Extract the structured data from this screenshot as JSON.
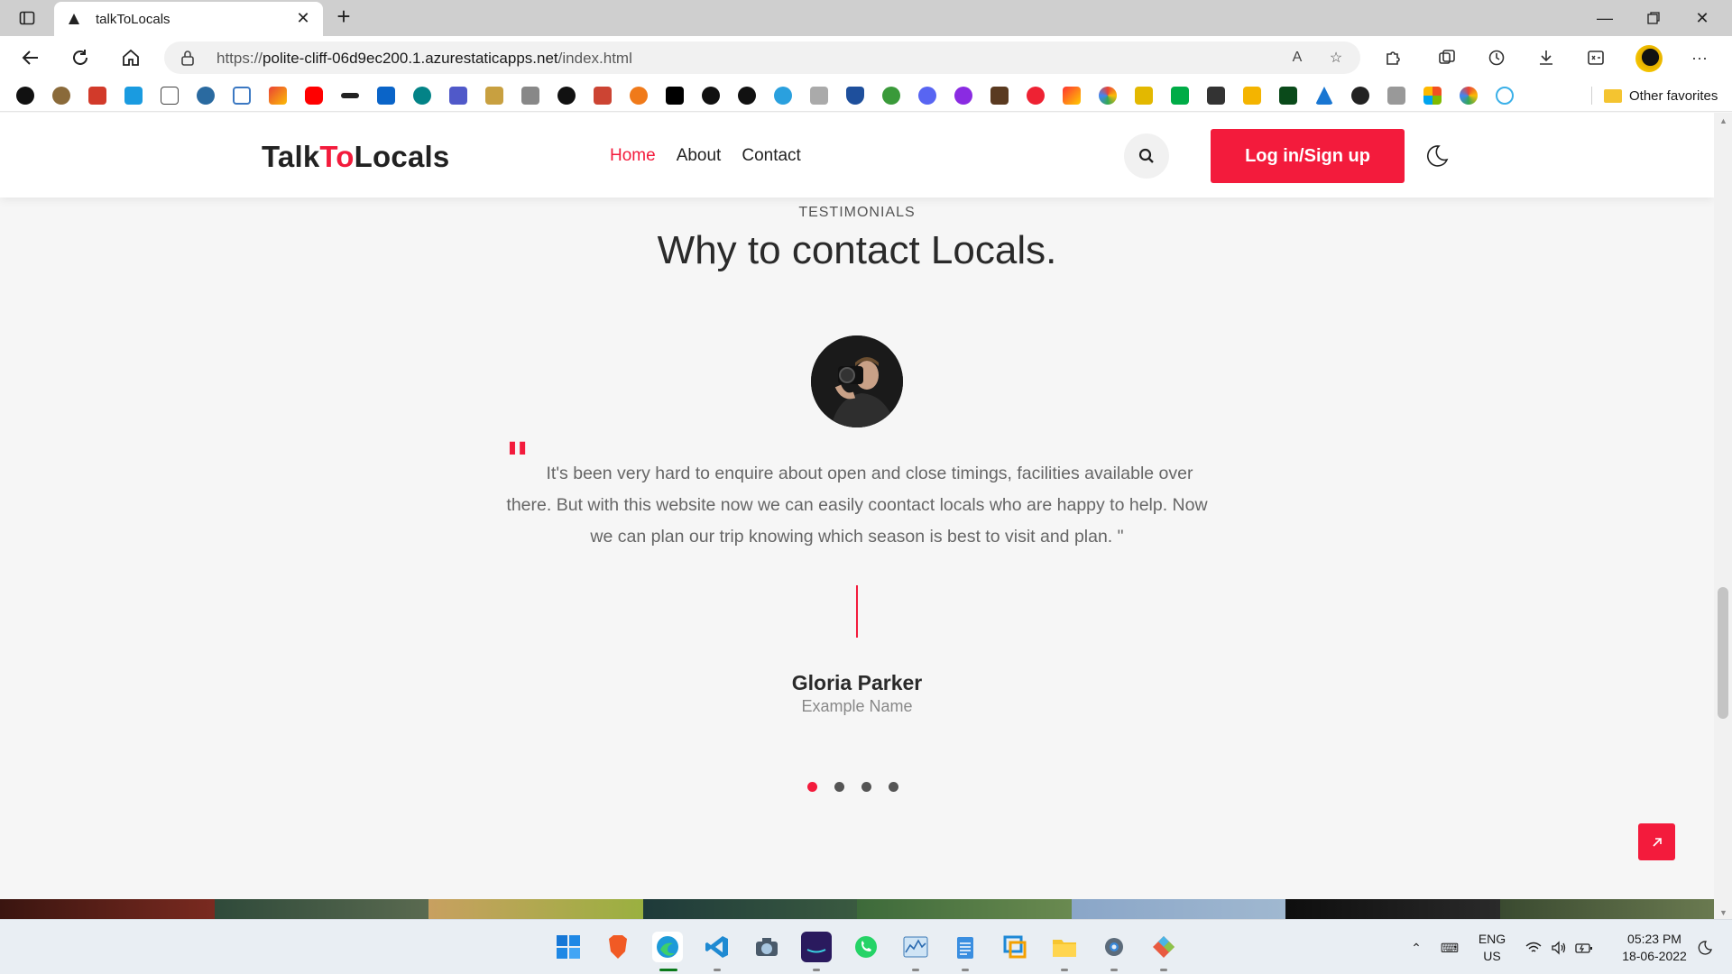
{
  "browser": {
    "tab_title": "talkToLocals",
    "new_tab": "+",
    "url_host_prefix": "https://",
    "url_host": "polite-cliff-06d9ec200.1.azurestaticapps.net",
    "url_path": "/index.html",
    "other_favorites": "Other favorites",
    "favorites_icons": [
      "wikipedia",
      "pdf",
      "pdf-red",
      "istock",
      "file",
      "wordpress",
      "square",
      "gmail",
      "youtube",
      "dots",
      "outlook",
      "sharepoint",
      "teams",
      "tool",
      "image",
      "circle",
      "grid",
      "flame",
      "hacker",
      "github",
      "github-2",
      "telegram",
      "keyboard",
      "shield",
      "circle-green",
      "discord",
      "purple-u",
      "cc",
      "no",
      "tool-2",
      "google",
      "camera",
      "meet",
      "tags",
      "box",
      "usf",
      "azure",
      "globe",
      "gear",
      "microsoft",
      "google-2",
      "cloud"
    ],
    "accent": "#f31b3c"
  },
  "site": {
    "logo_part1": "Talk",
    "logo_part2": "To",
    "logo_part3": "Locals",
    "nav": [
      "Home",
      "About",
      "Contact"
    ],
    "active_nav": "Home",
    "login_label": "Log in/Sign up"
  },
  "testimonials": {
    "subheading": "TESTIMONIALS",
    "heading": "Why to contact Locals.",
    "quote_mark": "\"",
    "quote": "It's been very hard to enquire about open and close timings, facilities available over there. But with this website now we can easily coontact locals who are happy to help. Now we can plan our trip knowing which season is best to visit and plan. \"",
    "name": "Gloria Parker",
    "role": "Example Name",
    "slides": 4,
    "active_slide": 1
  },
  "taskbar": {
    "apps": [
      "start-icon",
      "brave-icon",
      "edge-icon",
      "vscode-icon",
      "camera-icon",
      "amazon-music-icon",
      "whatsapp-icon",
      "monitor-icon",
      "notepad-icon",
      "remote-desktop-icon",
      "file-explorer-icon",
      "settings-icon",
      "git-icon"
    ],
    "lang_line1": "ENG",
    "lang_line2": "US",
    "time": "05:23 PM",
    "date": "18-06-2022"
  }
}
